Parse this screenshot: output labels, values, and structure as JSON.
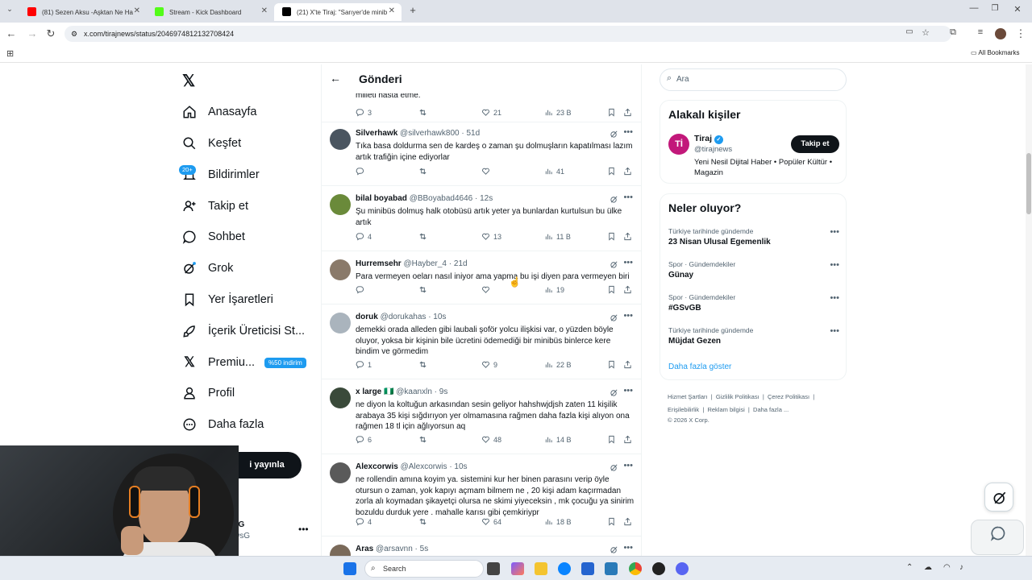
{
  "browser": {
    "tabs": [
      {
        "title": "(81) Sezen Aksu -Aşktan Ne Ha",
        "color": "#ff0000"
      },
      {
        "title": "Stream - Kick Dashboard",
        "color": "#53fc18"
      },
      {
        "title": "(21) X'te Tiraj: \"Sarıyer'de minib",
        "color": "#000000"
      }
    ],
    "url": "x.com/tirajnews/status/2046974812132708424",
    "bookmarks_label": "All Bookmarks"
  },
  "nav": {
    "items": [
      {
        "label": "Anasayfa",
        "icon": "home-icon"
      },
      {
        "label": "Keşfet",
        "icon": "search-icon"
      },
      {
        "label": "Bildirimler",
        "icon": "bell-icon",
        "badge": "20+"
      },
      {
        "label": "Takip et",
        "icon": "follow-icon"
      },
      {
        "label": "Sohbet",
        "icon": "chat-icon"
      },
      {
        "label": "Grok",
        "icon": "grok-icon"
      },
      {
        "label": "Yer İşaretleri",
        "icon": "bookmark-icon"
      },
      {
        "label": "İçerik Üreticisi St...",
        "icon": "rocket-icon"
      },
      {
        "label": "Premiu...",
        "icon": "x-icon",
        "badge": "%50 indirim"
      },
      {
        "label": "Profil",
        "icon": "person-icon"
      },
      {
        "label": "Daha fazla",
        "icon": "more-icon"
      }
    ],
    "post_button": "i yayınla",
    "account": {
      "name": "sG",
      "handle": "wsG"
    }
  },
  "header": {
    "title": "Gönderi"
  },
  "posts": [
    {
      "name": "",
      "handle": "",
      "time": "",
      "text": "milleti hasta etme.",
      "replies": "3",
      "reposts": "",
      "likes": "21",
      "views": "23 B",
      "avatar": "#999"
    },
    {
      "name": "Silverhawk",
      "handle": "@silverhawk800",
      "time": "· 51d",
      "text": "Tıka basa doldurma sen de kardeş o zaman şu dolmuşların kapatılması lazım artık trafiğin içine ediyorlar",
      "replies": "",
      "reposts": "",
      "likes": "",
      "views": "41",
      "avatar": "#4a5560"
    },
    {
      "name": "bilal boyabad",
      "handle": "@BBoyabad4646",
      "time": "· 12s",
      "text": "Şu minibüs dolmuş halk otobüsü artık yeter ya bunlardan kurtulsun bu ülke artık",
      "replies": "4",
      "reposts": "",
      "likes": "13",
      "views": "11 B",
      "avatar": "#6a8a3a"
    },
    {
      "name": "Hurremsehr",
      "handle": "@Hayber_4",
      "time": "· 21d",
      "text": "Para vermeyen oeları nasıl iniyor ama yapma bu işi diyen para vermeyen biri",
      "replies": "",
      "reposts": "",
      "likes": "",
      "views": "19",
      "avatar": "#8a7a6a"
    },
    {
      "name": "doruk",
      "handle": "@dorukahas",
      "time": "· 10s",
      "text": "demekki orada alleden gibi laubali şoför yolcu ilişkisi var, o yüzden böyle oluyor, yoksa bir kişinin bile ücretini ödemediği bir minibüs binlerce kere bindim ve görmedim",
      "replies": "1",
      "reposts": "",
      "likes": "9",
      "views": "22 B",
      "avatar": "#aab4bd"
    },
    {
      "name": "x large 🇳🇬",
      "handle": "@kaanxln",
      "time": "· 9s",
      "text": "ne diyon la koltuğun arkasından sesin geliyor hahshwjdjsh zaten 11 kişilik arabaya 35 kişi sığdırıyon yer olmamasına rağmen daha fazla kişi alıyon ona rağmen 18 tl için ağlıyorsun aq",
      "replies": "6",
      "reposts": "",
      "likes": "48",
      "views": "14 B",
      "avatar": "#3a4a3a"
    },
    {
      "name": "Alexcorwis",
      "handle": "@Alexcorwis",
      "time": "· 10s",
      "text": "ne rollendin amına koyim ya.  sistemini kur her binen parasını verip öyle otursun o zaman, yok kapıyı açmam bilmem ne , 20 kişi adam kaçırmadan zorla alı koymadan şikayetçi olursa ne skimi yiyeceksin , mk çocuğu ya sinirim bozuldu durduk yere . mahalle karısı gibi çemkiriypr",
      "replies": "4",
      "reposts": "",
      "likes": "64",
      "views": "18 B",
      "avatar": "#5a5a5a"
    },
    {
      "name": "Aras",
      "handle": "@arsavnn",
      "time": "· 5s",
      "text": "",
      "replies": "",
      "reposts": "",
      "likes": "",
      "views": "",
      "avatar": "#7a6a5a"
    }
  ],
  "search": {
    "placeholder": "Ara"
  },
  "related": {
    "title": "Alakalı kişiler",
    "person": {
      "name": "Tiraj",
      "handle": "@tirajnews",
      "bio": "Yeni Nesil Dijital Haber • Popüler Kültür • Magazin",
      "follow": "Takip et"
    }
  },
  "trends": {
    "title": "Neler oluyor?",
    "items": [
      {
        "category": "Türkiye tarihinde gündemde",
        "title": "23 Nisan Ulusal Egemenlik"
      },
      {
        "category": "Spor · Gündemdekiler",
        "title": "Günay"
      },
      {
        "category": "Spor · Gündemdekiler",
        "title": "#GSvGB"
      },
      {
        "category": "Türkiye tarihinde gündemde",
        "title": "Müjdat Gezen"
      }
    ],
    "show_more": "Daha fazla göster"
  },
  "footer": {
    "links1": [
      "Hizmet Şartları",
      "Gizlilik Politikası",
      "Çerez Politikası"
    ],
    "links2": [
      "Erişilebilirlik",
      "Reklam bilgisi",
      "Daha fazla ..."
    ],
    "copyright": "© 2026 X Corp."
  },
  "taskbar": {
    "search": "Search"
  },
  "colors": {
    "accent": "#1d9bf0",
    "text": "#0f1419",
    "muted": "#536471"
  }
}
